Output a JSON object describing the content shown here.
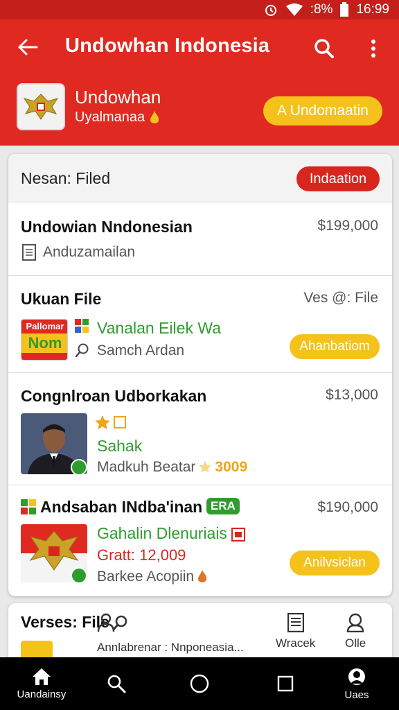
{
  "status_bar": {
    "battery_text": ":8%",
    "time": "16:99"
  },
  "app_bar": {
    "title": "Undowhan Indonesia"
  },
  "app_info": {
    "name": "Undowhan",
    "subtitle": "Uyalmanaa",
    "install_label": "A Undomaatin"
  },
  "card": {
    "header_label": "Nesan: Filed",
    "header_badge": "Indaation",
    "items": [
      {
        "title": "Undowian Nndonesian",
        "price": "$199,000",
        "meta": "Anduzamailan"
      },
      {
        "title": "Ukuan File",
        "right_text": "Ves @: File",
        "line1": "Vanalan Eilek Wa",
        "line2": "Samch Ardan",
        "action": "Ahanbatiom",
        "thumb_text_top": "Pallomar",
        "thumb_text_mid": "Nom"
      },
      {
        "title": "Congnlroan Udborkakan",
        "price": "$13,000",
        "line1": "Sahak",
        "line2": "Madkuh Beatar",
        "line2_value": "3009"
      },
      {
        "title": "Andsaban INdba'inan",
        "tag": "ERA",
        "price": "$190,000",
        "line1": "Gahalin Dlenuriais",
        "line2": "Gratt: 12,009",
        "line3": "Barkee Acopiin",
        "action": "Anilvsiclan"
      }
    ]
  },
  "peek": {
    "title": "Verses: File",
    "tabs": [
      {
        "label": "Annlabrenar : Nnponeasia...",
        "icon": "none"
      },
      {
        "label": "Wracek",
        "icon": "document-icon"
      },
      {
        "label": "Olle",
        "icon": "person-icon"
      }
    ]
  },
  "nav": {
    "home_label": "Uandainsy",
    "profile_label": "Uaes"
  },
  "colors": {
    "primary_red": "#e02921",
    "accent_yellow": "#f5c21c",
    "green": "#2e9d2e",
    "badge_red": "#d9261d"
  }
}
